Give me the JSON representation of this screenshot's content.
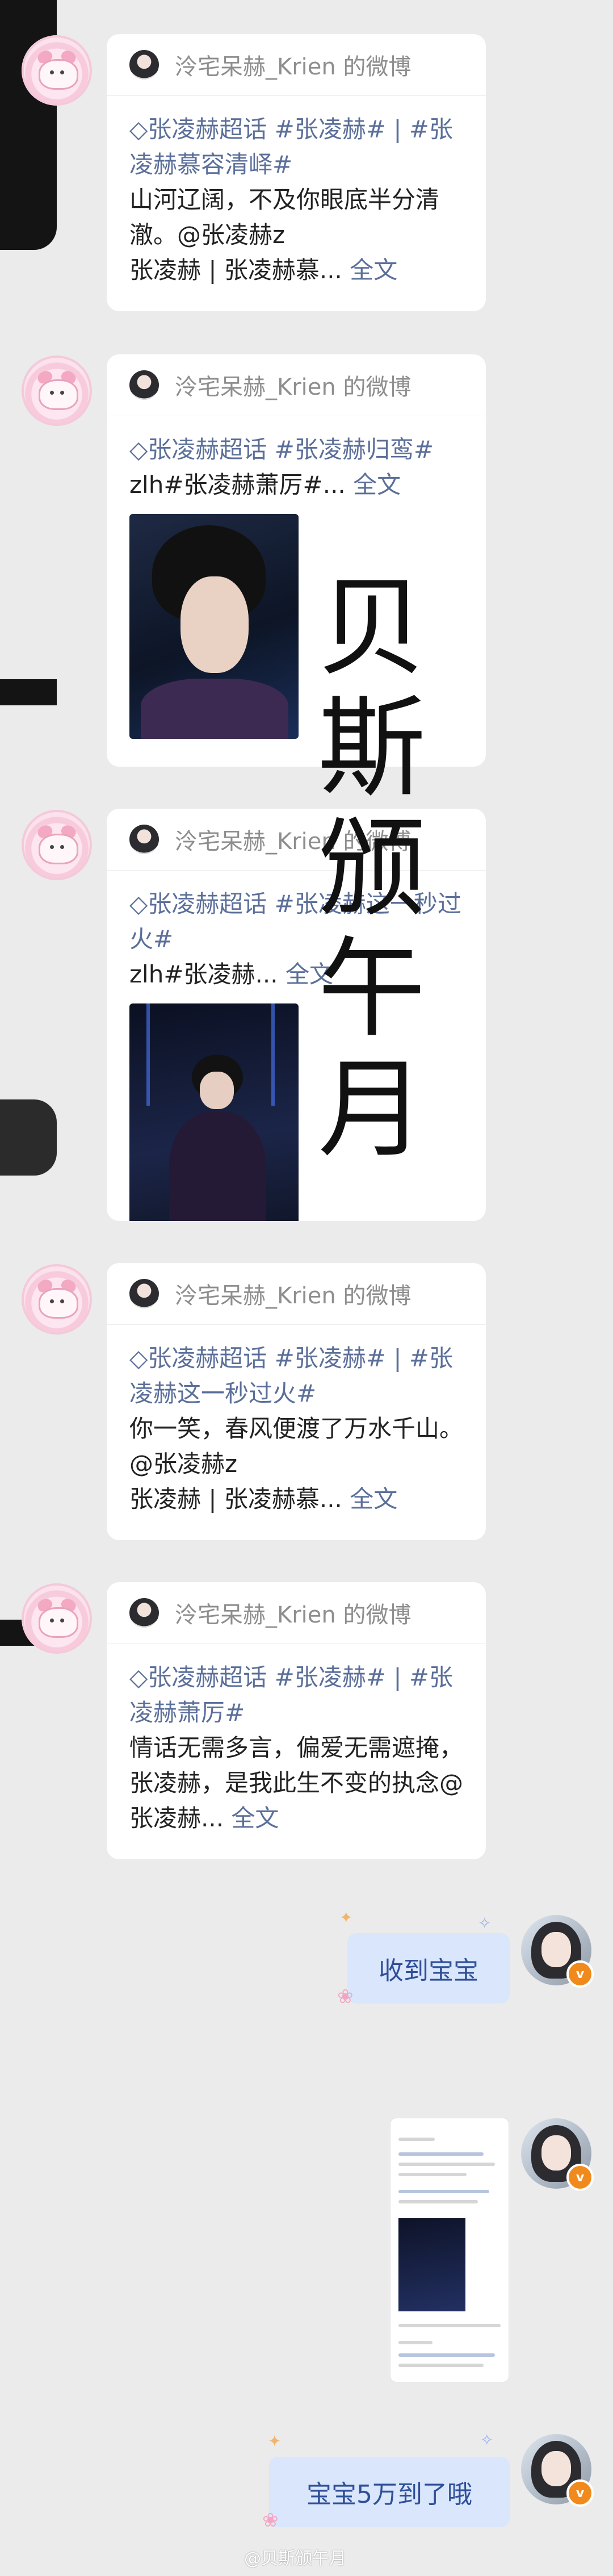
{
  "source_label": "泠宅呆赫_Krien 的微博",
  "more_label": "全文",
  "cards": [
    {
      "tags": "◇张凌赫超话 #张凌赫# | #张凌赫慕容清峄#",
      "text": "山河辽阔，不及你眼底半分清澈。@张凌赫z",
      "ellipsis_text": "张凌赫 | 张凌赫慕..."
    },
    {
      "tags": "◇张凌赫超话 #张凌赫归鸾#",
      "ellipsis_text": "zlh#张凌赫萧厉#..."
    },
    {
      "tags": "◇张凌赫超话 #张凌赫这一秒过火#",
      "ellipsis_text": "zlh#张凌赫..."
    },
    {
      "tags": "◇张凌赫超话 #张凌赫# | #张凌赫这一秒过火#",
      "text": "你一笑，春风便渡了万水千山。@张凌赫z",
      "ellipsis_text": "张凌赫 | 张凌赫慕..."
    },
    {
      "tags": "◇张凌赫超话 #张凌赫# | #张凌赫萧厉#",
      "text": "情话无需多言，偏爱无需遮掩，张凌赫，是我此生不变的执念",
      "ellipsis_text": "@张凌赫..."
    }
  ],
  "bubbles": {
    "received": "收到宝宝",
    "arrived": "宝宝5万到了哦"
  },
  "watermark": [
    "贝",
    "斯",
    "颁",
    "午",
    "月"
  ],
  "footer_mark": "@贝斯颁午月",
  "avatar_badge": "v"
}
